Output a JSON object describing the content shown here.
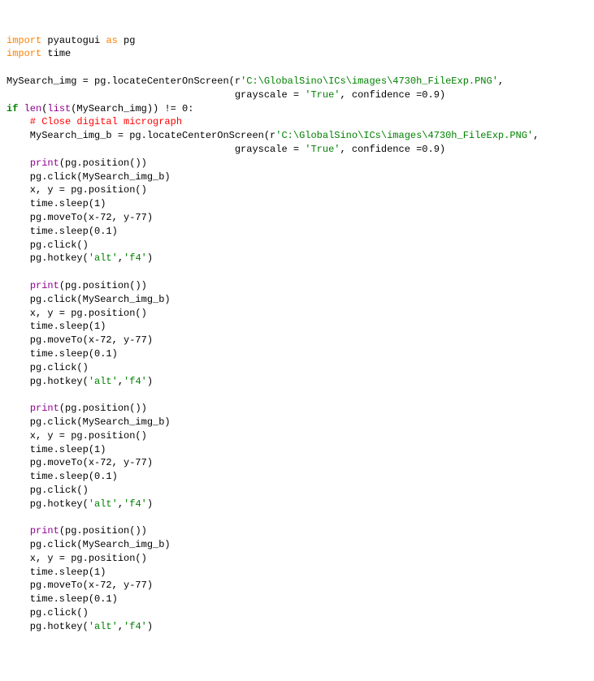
{
  "code": {
    "l1a": "import",
    "l1b": " pyautogui ",
    "l1c": "as",
    "l1d": " pg",
    "l2a": "import",
    "l2b": " time",
    "blank": "",
    "l4a": "MySearch_img = pg.locateCenterOnScreen(r",
    "l4b": "'C:\\GlobalSino\\ICs\\images\\4730h_FileExp.PNG'",
    "l4c": ",",
    "l5a": "                                       grayscale = ",
    "l5b": "'True'",
    "l5c": ", confidence =0.9)                   ",
    "l6a": "if",
    "l6b": " ",
    "l6c": "len",
    "l6d": "(",
    "l6e": "list",
    "l6f": "(MySearch_img)) != 0:",
    "l7": "    # Close digital micrograph",
    "l8a": "    MySearch_img_b = pg.locateCenterOnScreen(r",
    "l8b": "'C:\\GlobalSino\\ICs\\images\\4730h_FileExp.PNG'",
    "l8c": ",",
    "l9a": "                                       grayscale = ",
    "l9b": "'True'",
    "l9c": ", confidence =0.9)",
    "b1": "    ",
    "b2": "print",
    "b3": "(pg.position())",
    "b4": "    pg.click(MySearch_img_b)",
    "b5": "    x, y = pg.position()",
    "b6": "    time.sleep(1)",
    "b7": "    pg.moveTo(x-72, y-77)",
    "b8": "    time.sleep(0.1)",
    "b9": "    pg.click()",
    "b10a": "    pg.hotkey(",
    "b10b": "'alt'",
    "b10c": ",",
    "b10d": "'f4'",
    "b10e": ")"
  }
}
